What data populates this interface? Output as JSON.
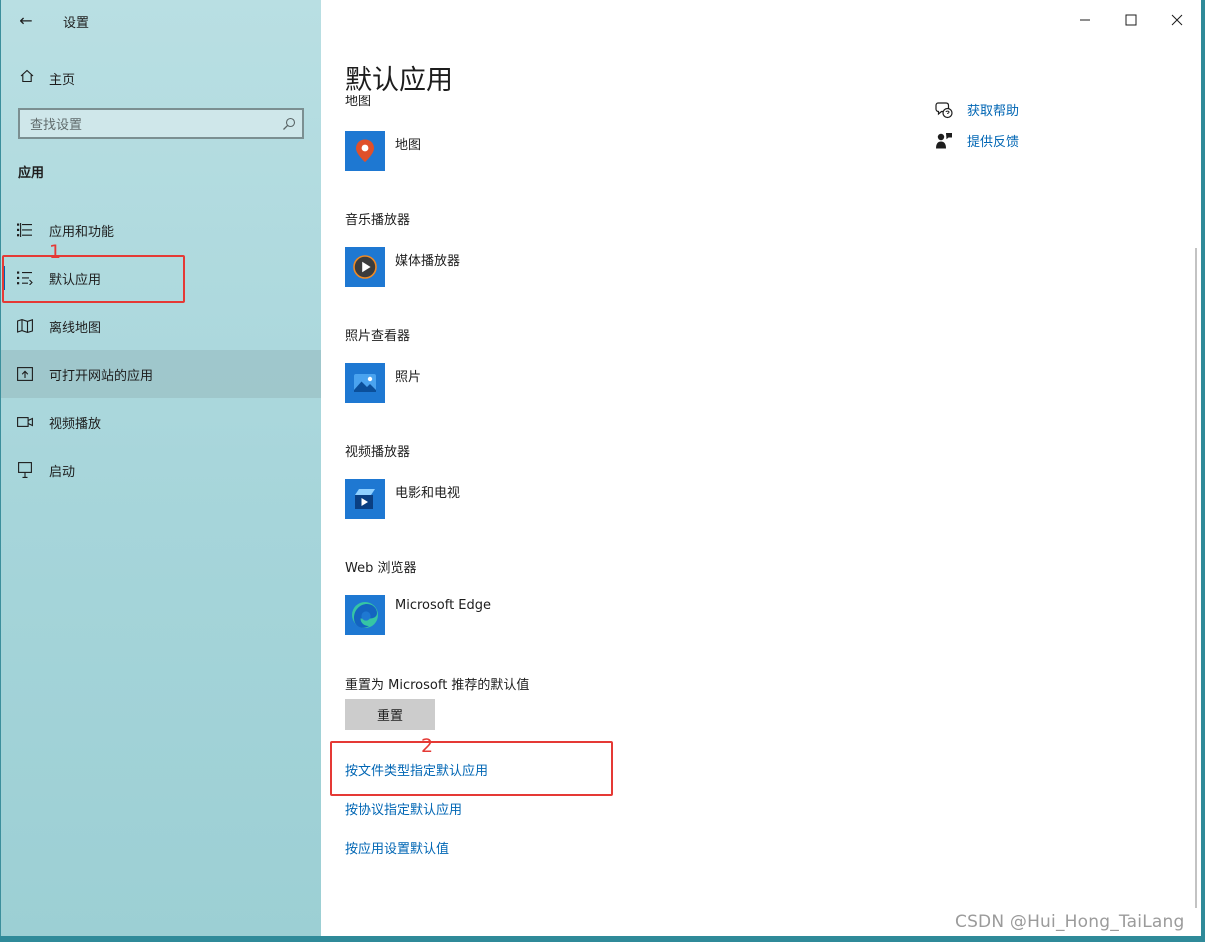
{
  "window": {
    "title": "设置",
    "back_glyph": "←"
  },
  "sidebar": {
    "home": {
      "label": "主页",
      "icon": "home-icon"
    },
    "search": {
      "placeholder": "查找设置",
      "icon": "search-icon"
    },
    "section_title": "应用",
    "items": [
      {
        "label": "应用和功能",
        "icon": "apps-features-icon",
        "state": "normal"
      },
      {
        "label": "默认应用",
        "icon": "default-apps-icon",
        "state": "selected"
      },
      {
        "label": "离线地图",
        "icon": "offline-maps-icon",
        "state": "normal"
      },
      {
        "label": "可打开网站的应用",
        "icon": "apps-for-websites-icon",
        "state": "hover"
      },
      {
        "label": "视频播放",
        "icon": "video-playback-icon",
        "state": "normal"
      },
      {
        "label": "启动",
        "icon": "startup-icon",
        "state": "normal"
      }
    ]
  },
  "main": {
    "page_title": "默认应用",
    "cut_off_label": "地图",
    "defaults": [
      {
        "category": "",
        "app": "地图",
        "icon": "maps-app-icon"
      },
      {
        "category": "音乐播放器",
        "app": "媒体播放器",
        "icon": "media-player-icon"
      },
      {
        "category": "照片查看器",
        "app": "照片",
        "icon": "photos-app-icon"
      },
      {
        "category": "视频播放器",
        "app": "电影和电视",
        "icon": "movies-tv-icon"
      },
      {
        "category": "Web 浏览器",
        "app": "Microsoft Edge",
        "icon": "edge-icon"
      }
    ],
    "reset": {
      "label": "重置为 Microsoft 推荐的默认值",
      "button": "重置"
    },
    "links": {
      "by_file_type": "按文件类型指定默认应用",
      "by_protocol": "按协议指定默认应用",
      "by_app": "按应用设置默认值"
    },
    "help": {
      "get_help": "获取帮助",
      "give_feedback": "提供反馈"
    }
  },
  "annotations": {
    "marker_1": "1",
    "marker_2": "2",
    "color": "#e53935"
  },
  "watermark": "CSDN @Hui_Hong_TaiLang",
  "colors": {
    "accent": "#0063b1",
    "link": "#0066b4",
    "tile_blue": "#1e78d2",
    "sidebar_bg": "#a6d5da",
    "map_pin": "#e0502a"
  }
}
